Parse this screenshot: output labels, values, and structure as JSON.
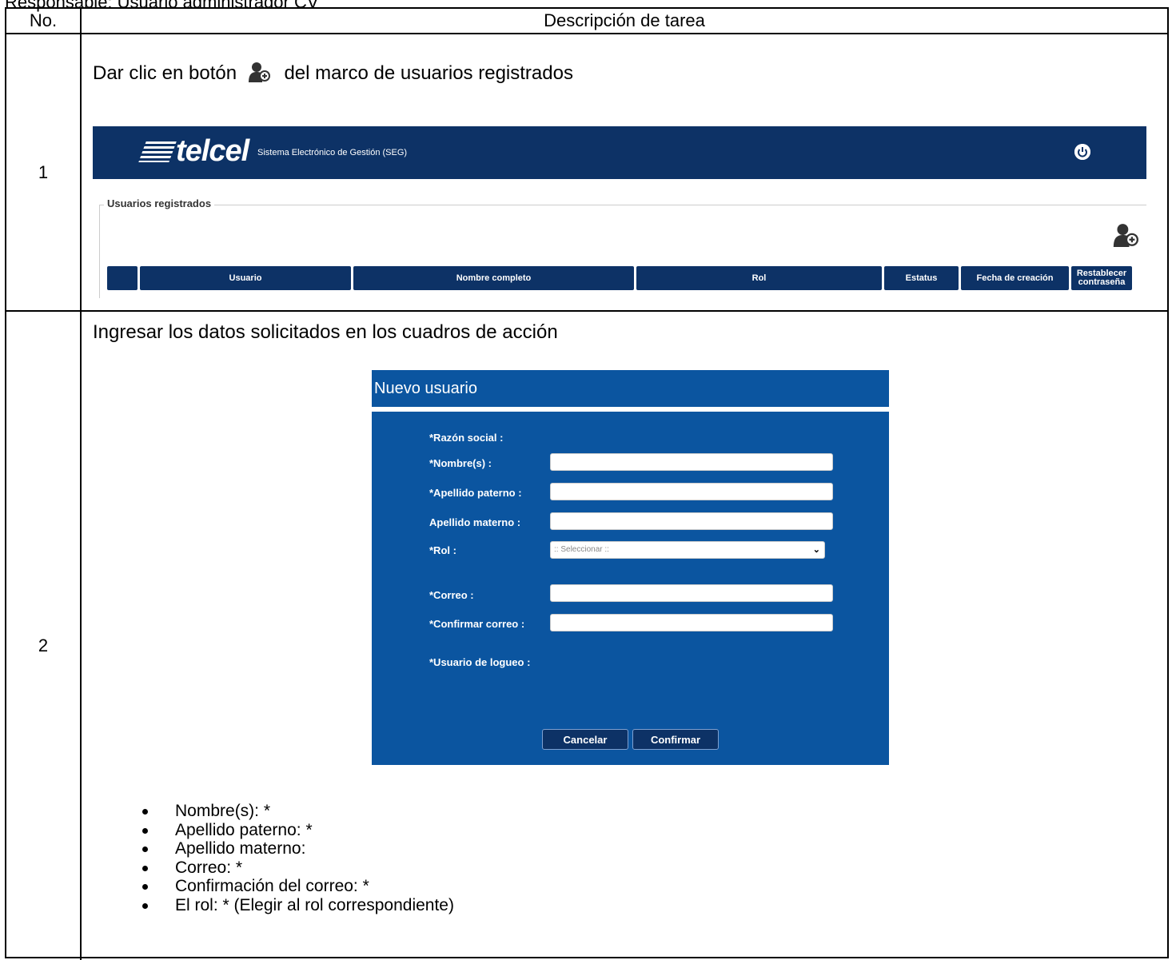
{
  "responsible_line": "Responsable: Usuario administrador CV",
  "table": {
    "col_no": "No.",
    "col_desc": "Descripción de tarea"
  },
  "step1": {
    "number": "1",
    "text_before": "Dar clic en botón",
    "text_after": "del marco de usuarios registrados",
    "screenshot": {
      "logo": "telcel",
      "system_name": "Sistema Electrónico de Gestión (SEG)",
      "section_title": "Usuarios registrados",
      "columns": [
        "",
        "Usuario",
        "Nombre completo",
        "Rol",
        "Estatus",
        "Fecha de creación",
        "Restablecer contraseña"
      ],
      "bar_color": "#0d3266"
    }
  },
  "step2": {
    "number": "2",
    "text": "Ingresar los datos solicitados en los cuadros de acción",
    "modal": {
      "title": "Nuevo usuario",
      "color": "#0b55a0",
      "labels": {
        "razon": "*Razón social :",
        "nombre": "*Nombre(s) :",
        "paterno": "*Apellido paterno :",
        "materno": "Apellido materno :",
        "rol": "*Rol :",
        "correo": "*Correo :",
        "confirmar": "*Confirmar correo :",
        "usuario": "*Usuario de logueo :"
      },
      "rol_placeholder": ":: Seleccionar ::",
      "cancel": "Cancelar",
      "confirm": "Confirmar"
    },
    "bullets": [
      "Nombre(s): *",
      "Apellido paterno: *",
      "Apellido materno:",
      "Correo: *",
      "Confirmación del correo: *",
      "El rol: * (Elegir al rol correspondiente)"
    ]
  }
}
